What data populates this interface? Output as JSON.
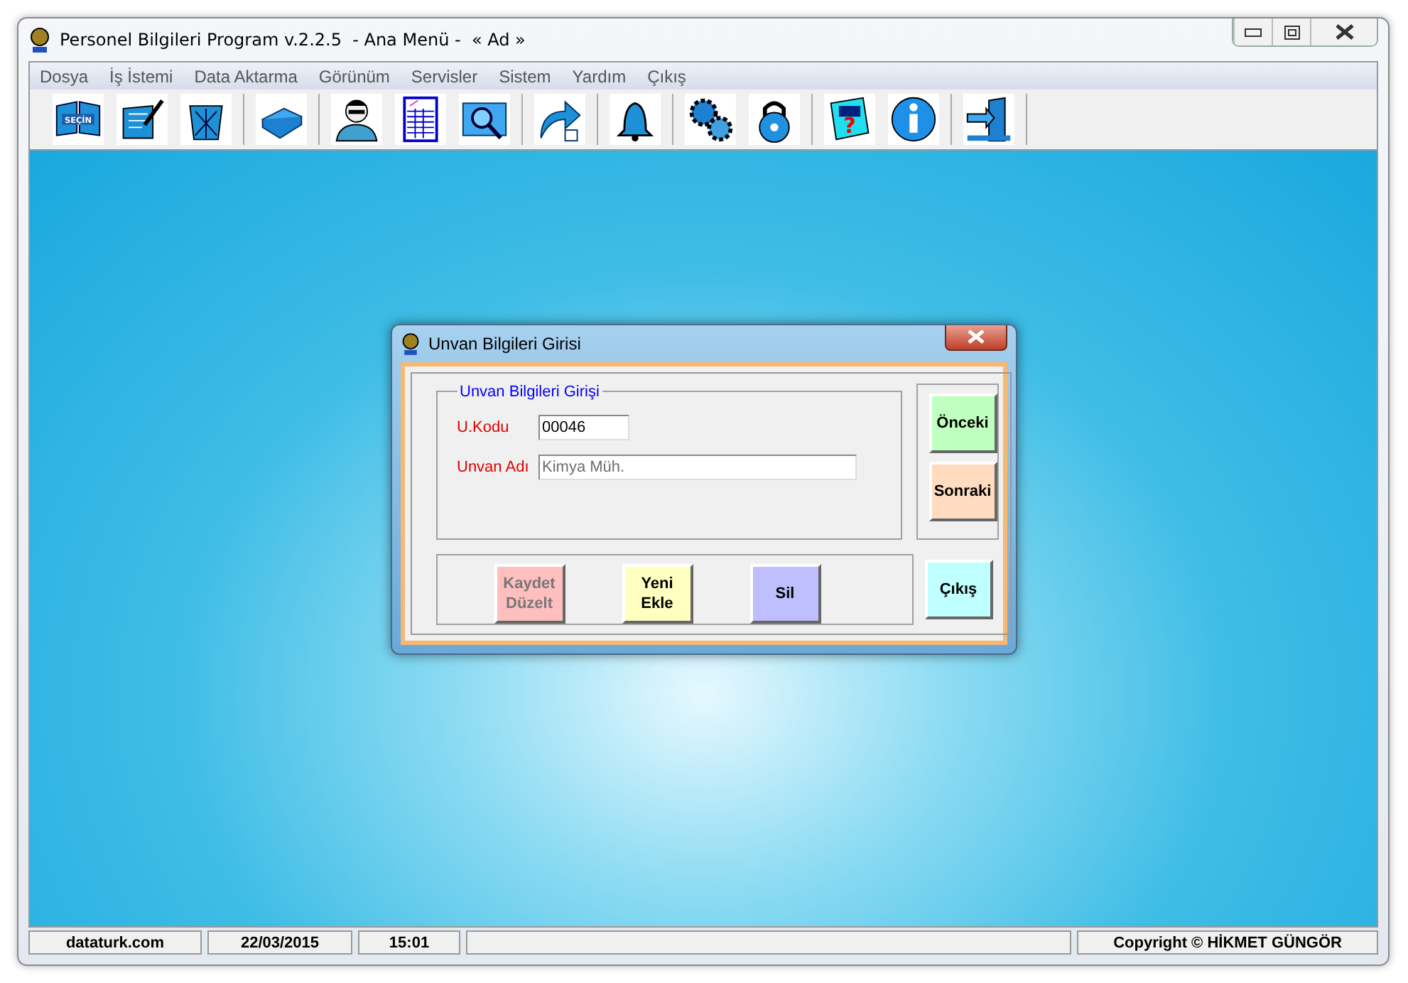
{
  "window": {
    "title": "Personel Bilgileri Program v.2.2.5  - Ana Menü -  « Ad »"
  },
  "menu": [
    "Dosya",
    "İş İstemi",
    "Data Aktarma",
    "Görünüm",
    "Servisler",
    "Sistem",
    "Yardım",
    "Çıkış"
  ],
  "toolbar": [
    [
      {
        "kind": "book",
        "label": "SEÇİN"
      },
      {
        "kind": "edit"
      },
      {
        "kind": "trash"
      }
    ],
    [
      {
        "kind": "printer"
      }
    ],
    [
      {
        "kind": "person"
      },
      {
        "kind": "sheet"
      },
      {
        "kind": "search"
      }
    ],
    [
      {
        "kind": "export"
      }
    ],
    [
      {
        "kind": "bell"
      }
    ],
    [
      {
        "kind": "gears"
      },
      {
        "kind": "lock"
      }
    ],
    [
      {
        "kind": "help",
        "label": "?"
      },
      {
        "kind": "info"
      }
    ],
    [
      {
        "kind": "exit"
      }
    ]
  ],
  "dialog": {
    "title": "Unvan Bilgileri Girisi",
    "group_title": "Unvan Bilgileri Girişi",
    "fields": [
      {
        "label": "U.Kodu",
        "value": "00046",
        "disabled": false
      },
      {
        "label": "Unvan Adı",
        "value": "Kimya Müh.",
        "disabled": true
      }
    ],
    "nav_buttons": [
      {
        "label": "Önceki",
        "color": "#bfffbf",
        "disabled": false
      },
      {
        "label": "Sonraki",
        "color": "#ffdcbf",
        "disabled": false
      }
    ],
    "action_buttons": [
      {
        "lines": [
          "Kaydet",
          "Düzelt"
        ],
        "color": "#ffbfbf",
        "disabled": true
      },
      {
        "lines": [
          "Yeni",
          "Ekle"
        ],
        "color": "#ffffbf",
        "disabled": false
      },
      {
        "lines": [
          "Sil"
        ],
        "color": "#bfbfff",
        "disabled": false
      }
    ],
    "exit_button": {
      "label": "Çıkış",
      "color": "#bfffff"
    }
  },
  "status_bar": [
    "dataturk.com",
    "22/03/2015",
    "15:01",
    "Copyright © HİKMET GÜNGÖR"
  ]
}
